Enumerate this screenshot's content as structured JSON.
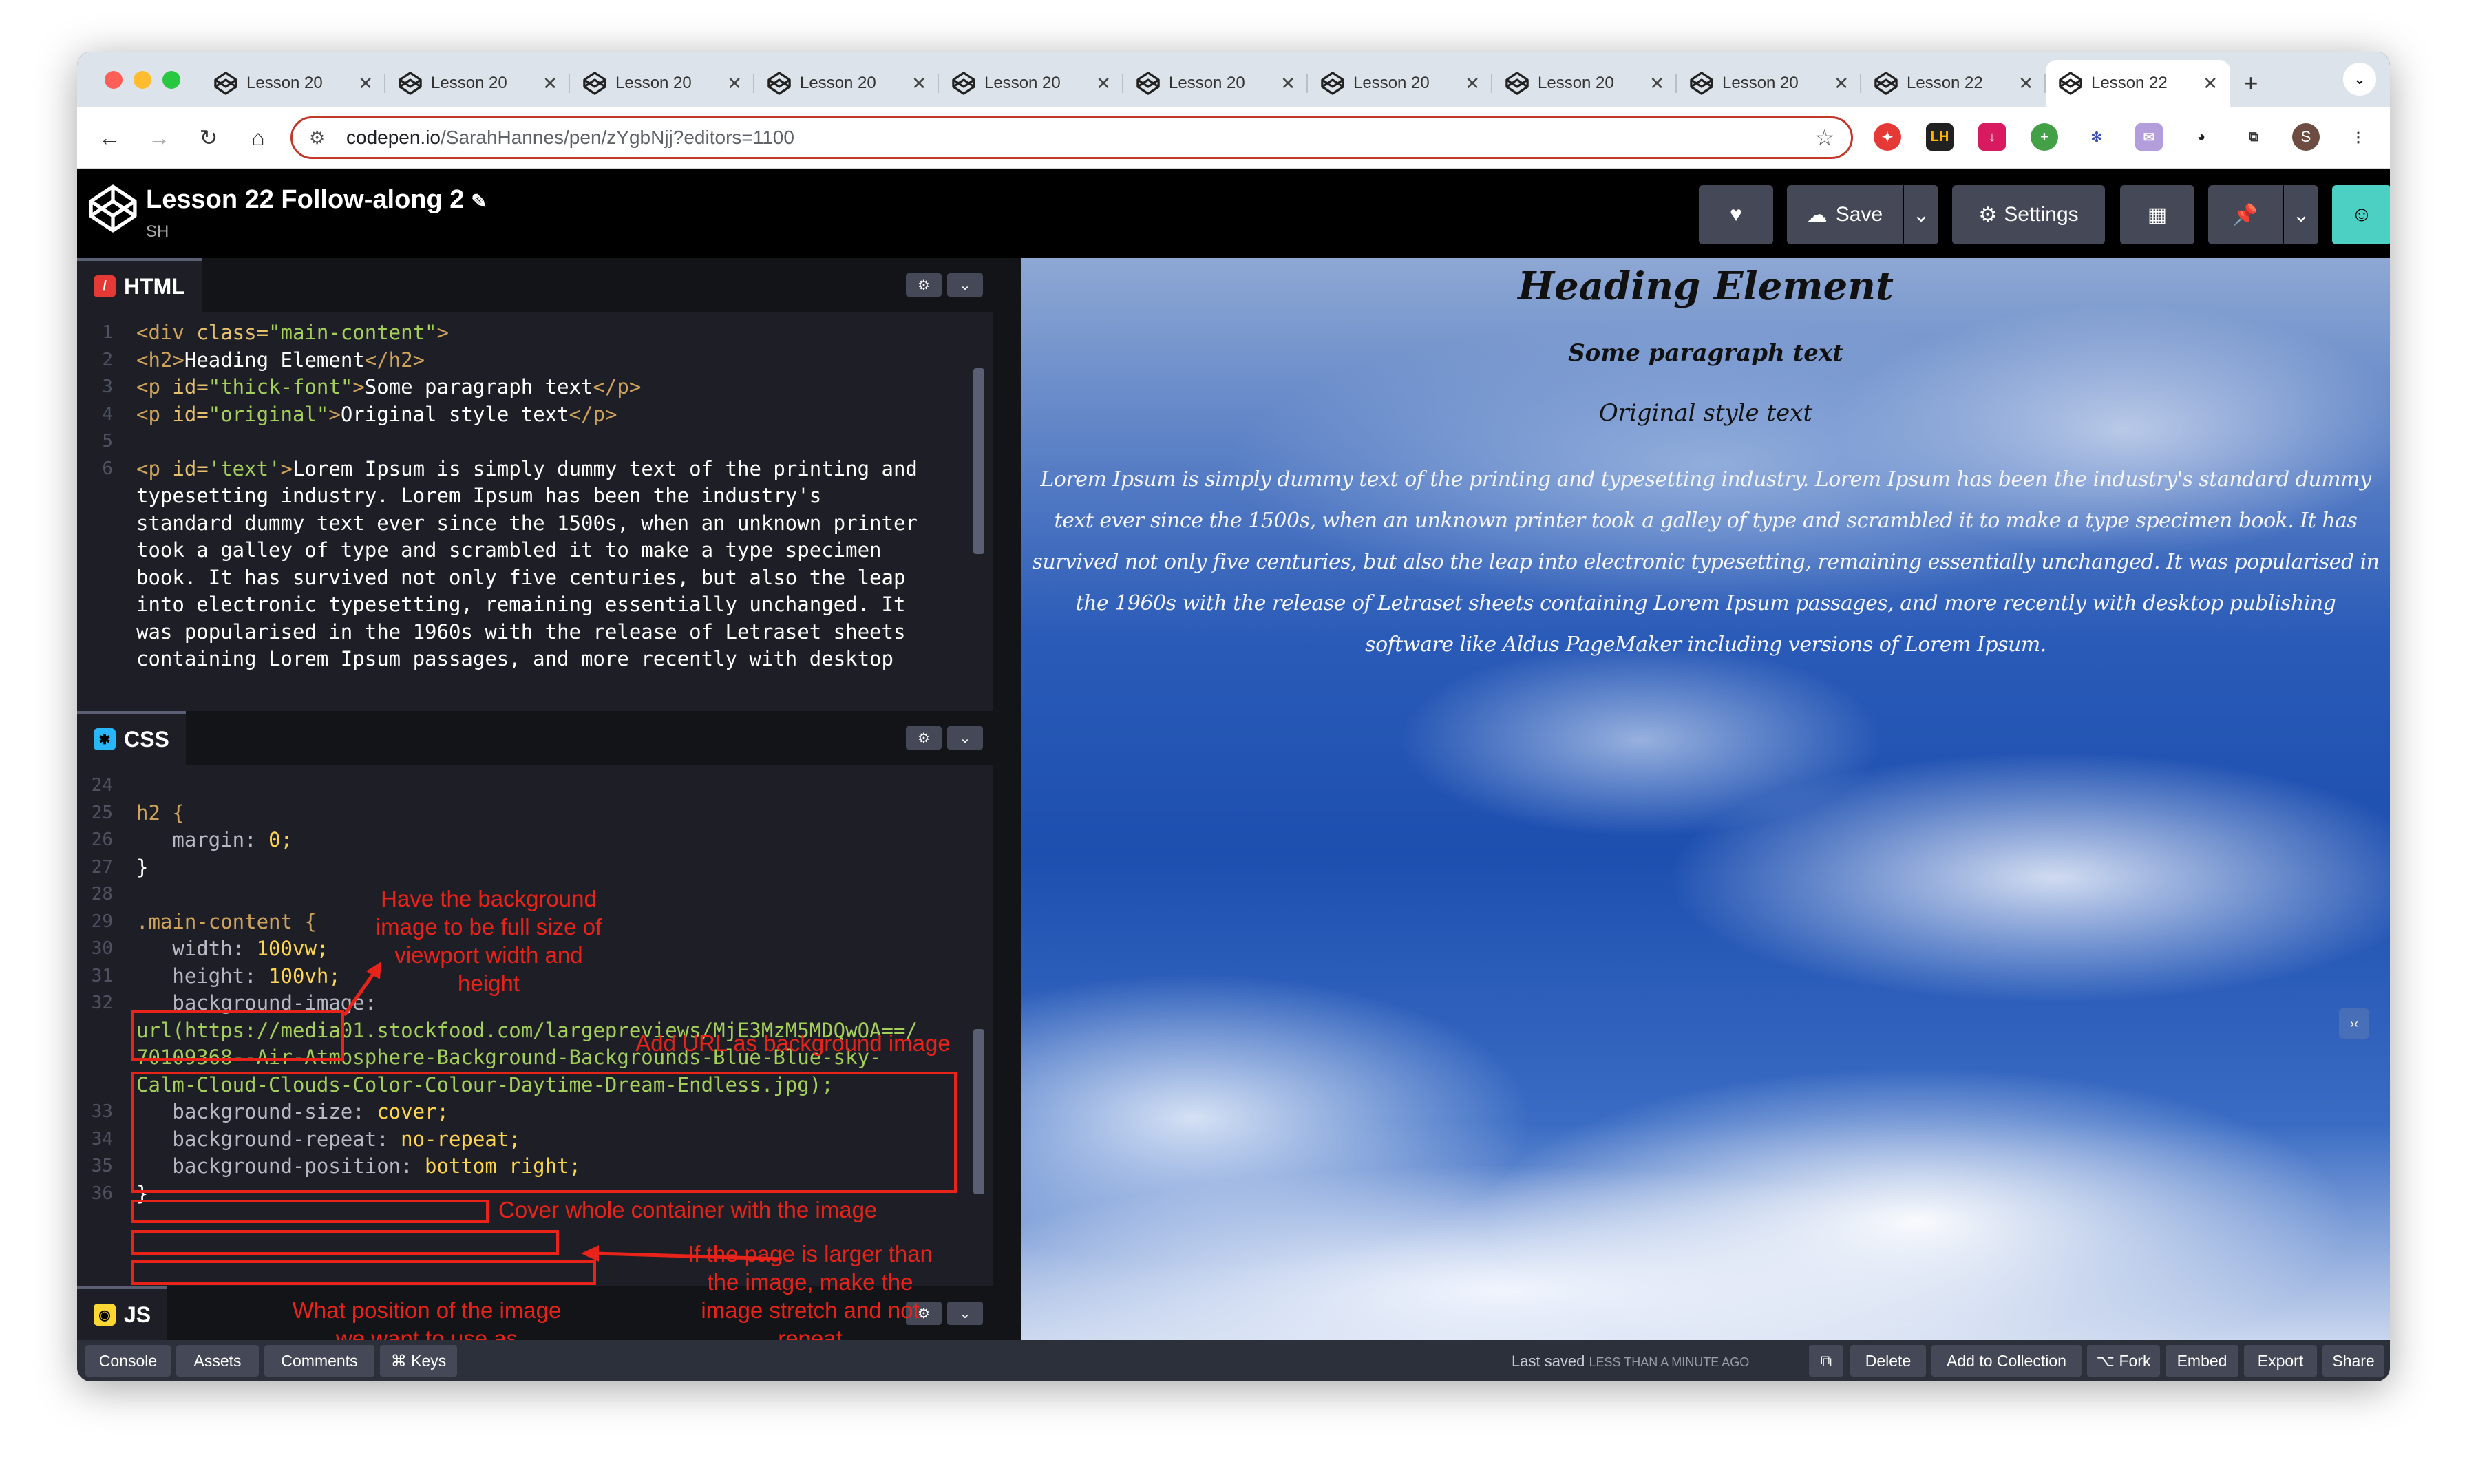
{
  "browser": {
    "tabs": [
      {
        "label": "Lesson 20"
      },
      {
        "label": "Lesson 20"
      },
      {
        "label": "Lesson 20"
      },
      {
        "label": "Lesson 20"
      },
      {
        "label": "Lesson 20"
      },
      {
        "label": "Lesson 20"
      },
      {
        "label": "Lesson 20"
      },
      {
        "label": "Lesson 20"
      },
      {
        "label": "Lesson 20"
      },
      {
        "label": "Lesson 22"
      },
      {
        "label": "Lesson 22"
      }
    ],
    "close_glyph": "✕",
    "new_tab": "+",
    "url_host": "codepen.io",
    "url_path": "/SarahHannes/pen/zYgbNjj?editors=1100",
    "avatar_letter": "S"
  },
  "header": {
    "title": "Lesson 22 Follow-along 2",
    "owner": "SH",
    "save_label": "Save",
    "settings_label": "Settings"
  },
  "html_pane": {
    "title": "HTML",
    "lines": [
      {
        "n": "1",
        "code": "<div class=\"main-content\">"
      },
      {
        "n": "2",
        "code": "<h2>Heading Element</h2>"
      },
      {
        "n": "3",
        "code": "<p id=\"thick-font\">Some paragraph text</p>"
      },
      {
        "n": "4",
        "code": "<p id=\"original\">Original style text</p>"
      },
      {
        "n": "5",
        "code": ""
      },
      {
        "n": "6",
        "code": "<p id='text'>Lorem Ipsum is simply dummy text of the printing and"
      },
      {
        "n": "",
        "code": "typesetting industry. Lorem Ipsum has been the industry's"
      },
      {
        "n": "",
        "code": "standard dummy text ever since the 1500s, when an unknown printer"
      },
      {
        "n": "",
        "code": "took a galley of type and scrambled it to make a type specimen"
      },
      {
        "n": "",
        "code": "book. It has survived not only five centuries, but also the leap"
      },
      {
        "n": "",
        "code": "into electronic typesetting, remaining essentially unchanged. It"
      },
      {
        "n": "",
        "code": "was popularised in the 1960s with the release of Letraset sheets"
      },
      {
        "n": "",
        "code": "containing Lorem Ipsum passages, and more recently with desktop"
      }
    ]
  },
  "css_pane": {
    "title": "CSS",
    "lines": [
      {
        "n": "24",
        "code": ""
      },
      {
        "n": "25",
        "code": "h2 {"
      },
      {
        "n": "26",
        "code": "   margin: 0;"
      },
      {
        "n": "27",
        "code": "}"
      },
      {
        "n": "28",
        "code": ""
      },
      {
        "n": "29",
        "code": ".main-content {"
      },
      {
        "n": "30",
        "code": "   width: 100vw;"
      },
      {
        "n": "31",
        "code": "   height: 100vh;"
      },
      {
        "n": "32",
        "code": "   background-image:"
      },
      {
        "n": "",
        "code": "url(https://media01.stockfood.com/largepreviews/MjE3MzM5MDQwOA==/"
      },
      {
        "n": "",
        "code": "70109368--Air-Atmosphere-Background-Backgrounds-Blue-Blue-sky-"
      },
      {
        "n": "",
        "code": "Calm-Cloud-Clouds-Color-Colour-Daytime-Dream-Endless.jpg);"
      },
      {
        "n": "33",
        "code": "   background-size: cover;"
      },
      {
        "n": "34",
        "code": "   background-repeat: no-repeat;"
      },
      {
        "n": "35",
        "code": "   background-position: bottom right;"
      },
      {
        "n": "36",
        "code": "}"
      }
    ]
  },
  "js_pane": {
    "title": "JS"
  },
  "annotations": {
    "viewport": "Have the background image to be full size of viewport width and height",
    "url": "Add URL as background image",
    "cover": "Cover whole container with the image",
    "repeat": "If the page is larger than the image, make the image stretch and not repeat",
    "position": "What position of the image we want to use as background"
  },
  "preview": {
    "heading": "Heading Element",
    "thick": "Some paragraph text",
    "original": "Original style text",
    "text": "Lorem Ipsum is simply dummy text of the printing and typesetting industry. Lorem Ipsum has been the industry's standard dummy text ever since the 1500s, when an unknown printer took a galley of type and scrambled it to make a type specimen book. It has survived not only five centuries, but also the leap into electronic typesetting, remaining essentially unchanged. It was popularised in the 1960s with the release of Letraset sheets containing Lorem Ipsum passages, and more recently with desktop publishing software like Aldus PageMaker including versions of Lorem Ipsum."
  },
  "footer": {
    "console": "Console",
    "assets": "Assets",
    "comments": "Comments",
    "keys": "⌘ Keys",
    "saved_prefix": "Last saved",
    "saved_time": "LESS THAN A MINUTE AGO",
    "delete": "Delete",
    "collection": "Add to Collection",
    "fork": "⌥ Fork",
    "embed": "Embed",
    "export": "Export",
    "share": "Share"
  },
  "colors": {
    "annotation": "#e8231a",
    "codepen_header": "#000000",
    "editor_bg": "#1e1f26",
    "button": "#444857"
  }
}
